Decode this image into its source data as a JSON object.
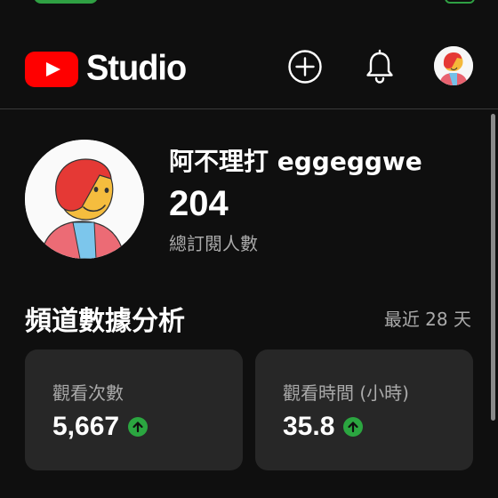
{
  "header": {
    "logo_text": "Studio",
    "icons": [
      "create-icon",
      "bell-icon",
      "account-avatar"
    ]
  },
  "channel": {
    "name": "阿不理打 eggeggwe",
    "subscriber_count": "204",
    "subscriber_label": "總訂閱人數"
  },
  "analytics": {
    "title": "頻道數據分析",
    "period": "最近 28 天",
    "cards": [
      {
        "label": "觀看次數",
        "value": "5,667",
        "trend": "up"
      },
      {
        "label": "觀看時間 (小時)",
        "value": "35.8",
        "trend": "up"
      }
    ]
  },
  "colors": {
    "background": "#0f0f0f",
    "card": "#272727",
    "youtube_red": "#ff0000",
    "trend_up": "#2ba640"
  }
}
